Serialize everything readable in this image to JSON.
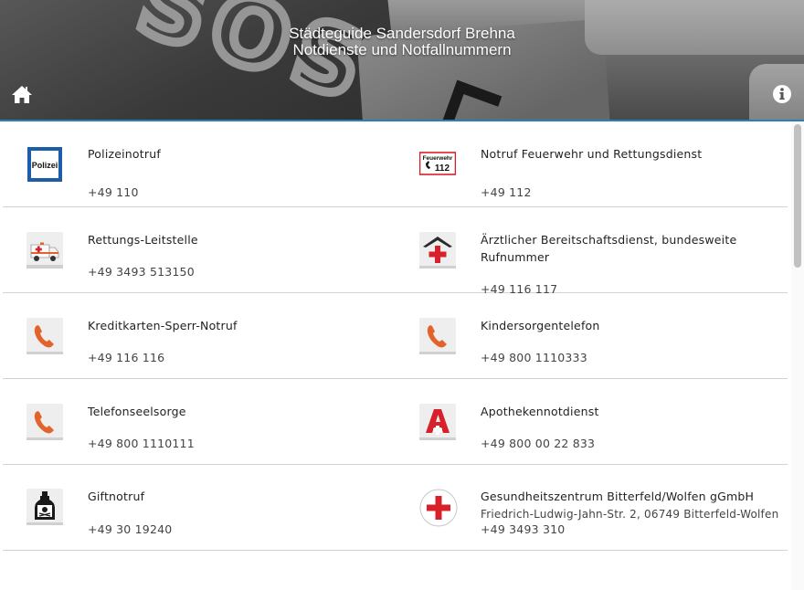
{
  "header": {
    "title_line1": "Städteguide Sandersdorf Brehna",
    "title_line2": "Notdienste und Notfallnummern",
    "home_icon": "home-icon",
    "info_icon": "info-icon"
  },
  "entries": [
    {
      "name": "Polizeinotruf",
      "phone": "+49 110",
      "icon": "police-sign-icon",
      "icon_text": "Polizei"
    },
    {
      "name": "Notruf Feuerwehr und Rettungsdienst",
      "phone": "+49 112",
      "icon": "fire-department-sign-icon",
      "icon_text_top": "Feuerwehr",
      "icon_text_num": "112"
    },
    {
      "name": "Rettungs-Leitstelle",
      "phone": "+49 3493 513150",
      "icon": "ambulance-icon"
    },
    {
      "name": "Ärztlicher Bereitschaftsdienst, bundesweite Rufnummer",
      "phone": "+49 116 117",
      "icon": "medical-house-icon"
    },
    {
      "name": "Kreditkarten-Sperr-Notruf",
      "phone": "+49 116 116",
      "icon": "phone-icon"
    },
    {
      "name": "Kindersorgentelefon",
      "phone": "+49 800 1110333",
      "icon": "phone-icon"
    },
    {
      "name": "Telefonseelsorge",
      "phone": "+49 800 1110111",
      "icon": "phone-icon"
    },
    {
      "name": "Apothekennotdienst",
      "phone": "+49 800 00 22 833",
      "icon": "pharmacy-icon"
    },
    {
      "name": "Giftnotruf",
      "phone": "+49 30 19240",
      "icon": "poison-bottle-icon"
    },
    {
      "name": "Gesundheitszentrum Bitterfeld/Wolfen gGmbH",
      "address": "Friedrich-Ludwig-Jahn-Str. 2, 06749 Bitterfeld-Wolfen",
      "phone": "+49 3493 310",
      "icon": "red-cross-icon"
    }
  ],
  "colors": {
    "accent": "#2b7fb8",
    "police_blue": "#1d5ca8",
    "red": "#d8202a",
    "phone_orange": "#e2642c"
  }
}
